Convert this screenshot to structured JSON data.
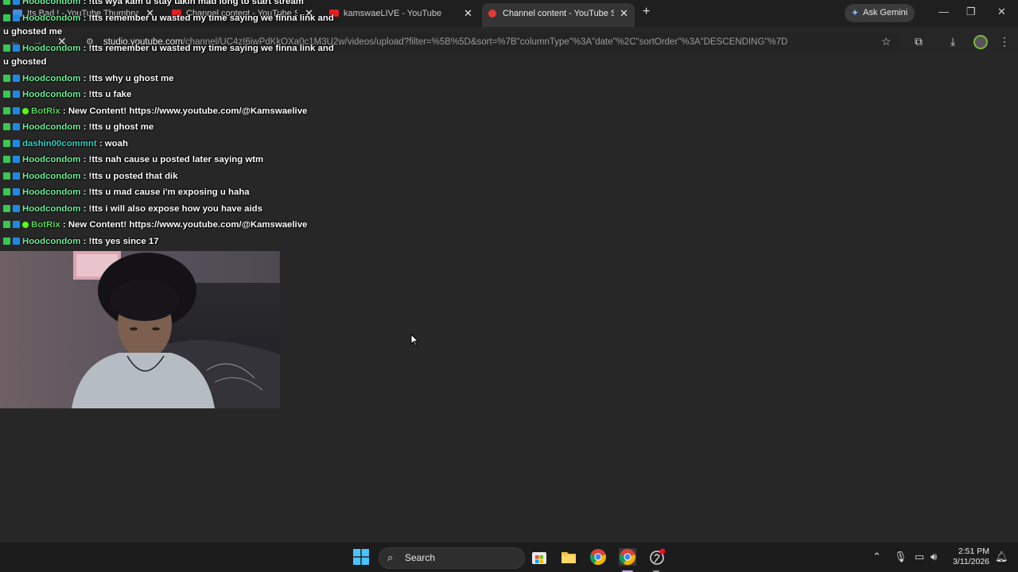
{
  "browser": {
    "tabs": [
      {
        "title": "Its Bad ! - YouTube Thumbnail",
        "active": false
      },
      {
        "title": "Channel content - YouTube Stu",
        "active": false
      },
      {
        "title": "kamswaeLIVE - YouTube",
        "active": false
      },
      {
        "title": "Channel content - YouTube Stu",
        "active": true
      }
    ],
    "new_tab": "+",
    "gemini_label": "Ask Gemini",
    "url_host": "studio.youtube.com",
    "url_path": "/channel/UC4zI6iwPdKkOXa0c1M3U2w/videos/upload?filter=%5B%5D&sort=%7B\"columnType\"%3A\"date\"%2C\"sortOrder\"%3A\"DESCENDING\"%7D",
    "window_controls": {
      "minimize": "—",
      "maximize": "❐",
      "close": "✕"
    }
  },
  "chat": {
    "messages": [
      {
        "user": "Hoodcondom",
        "text": " : !tts wya kam u stay takin mad long to start stream",
        "color": "#6ff09b"
      },
      {
        "user": "Hoodcondom",
        "text": " : !tts remember u wasted my time saying we finna link and u ghosted me",
        "color": "#6ff09b"
      },
      {
        "user": "Hoodcondom",
        "text": " : !tts remember u wasted my time saying we finna link and u ghosted",
        "color": "#6ff09b"
      },
      {
        "user": "Hoodcondom",
        "text": " : !tts why u ghost me",
        "color": "#6ff09b"
      },
      {
        "user": "Hoodcondom",
        "text": " : !tts u fake",
        "color": "#6ff09b"
      },
      {
        "user": "BotRix",
        "text": " : New Content! https://www.youtube.com/@Kamswaelive",
        "color": "#5dd860",
        "bot": true
      },
      {
        "user": "Hoodcondom",
        "text": " : !tts u ghost me",
        "color": "#6ff09b"
      },
      {
        "user": "dashin00commnt",
        "text": " : woah",
        "color": "#2fd5c5"
      },
      {
        "user": "Hoodcondom",
        "text": " : !tts nah cause u posted later saying wtm",
        "color": "#6ff09b"
      },
      {
        "user": "Hoodcondom",
        "text": " : !tts u posted that dik",
        "color": "#6ff09b"
      },
      {
        "user": "Hoodcondom",
        "text": " : !tts u mad cause i'm exposing u haha",
        "color": "#6ff09b"
      },
      {
        "user": "Hoodcondom",
        "text": " : !tts i will also expose how you have aids",
        "color": "#6ff09b"
      },
      {
        "user": "BotRix",
        "text": " : New Content! https://www.youtube.com/@Kamswaelive",
        "color": "#5dd860",
        "bot": true
      },
      {
        "user": "Hoodcondom",
        "text": " : !tts yes since 17",
        "color": "#6ff09b"
      }
    ]
  },
  "taskbar": {
    "search_label": "Search",
    "time": "2:51 PM",
    "date": "3/11/2026"
  },
  "icons": {
    "back": "back-arrow-icon",
    "forward": "forward-arrow-icon",
    "reload": "stop-icon",
    "bookmark": "star-icon",
    "extensions": "puzzle-icon",
    "download": "download-icon",
    "menu": "kebab-menu-icon"
  }
}
